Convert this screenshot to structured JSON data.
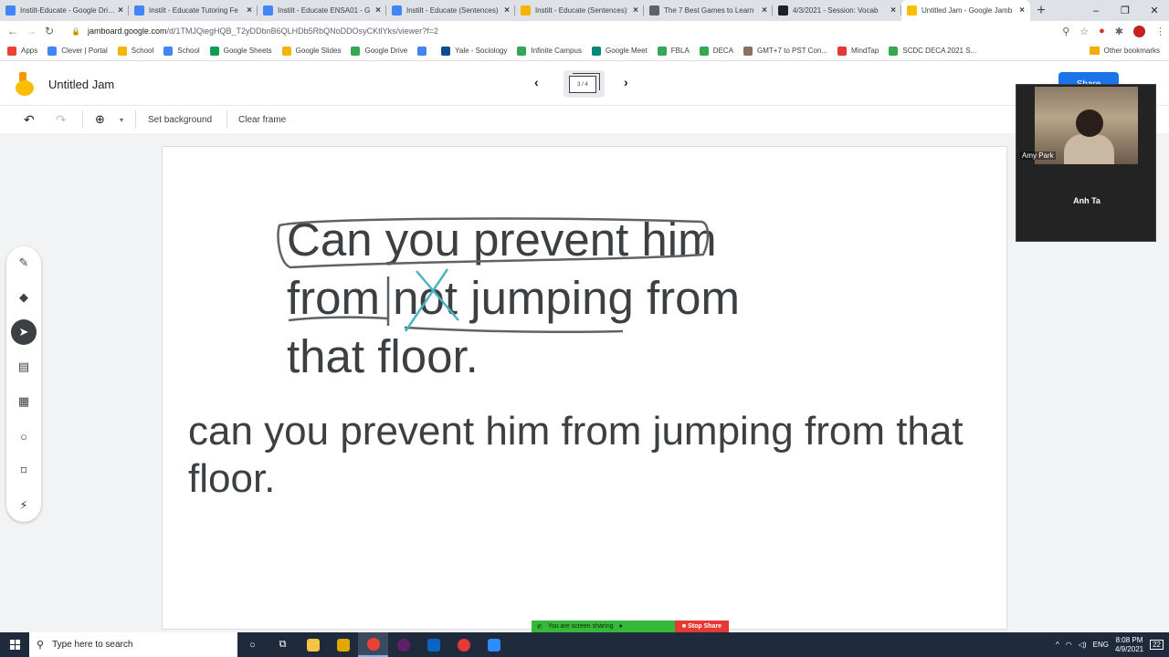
{
  "browser": {
    "tabs": [
      {
        "label": "Instilt-Educate - Google Drive",
        "color": "#4285f4"
      },
      {
        "label": "Instilt - Educate Tutoring Fe",
        "color": "#4285f4"
      },
      {
        "label": "Instilt - Educate ENSA01 - G",
        "color": "#4285f4"
      },
      {
        "label": "Instilt - Educate (Sentences)",
        "color": "#4285f4"
      },
      {
        "label": "Instilt - Educate (Sentences)",
        "color": "#f4b400"
      },
      {
        "label": "The 7 Best Games to Learn",
        "color": "#5f6368"
      },
      {
        "label": "4/3/2021 - Session: Vocab",
        "color": "#202124"
      },
      {
        "label": "Untitled Jam - Google Jamb",
        "color": "#fbbc04"
      }
    ],
    "new_tab": "+",
    "url_host": "jamboard.google.com",
    "url_path": "/d/1TMJQiegHQB_T2yDDbnB6QLHDb5RbQNoDDOsyCKtlYks/viewer?f=2",
    "bookmarks": [
      {
        "label": "Apps",
        "color": "#ea4335"
      },
      {
        "label": "Clever | Portal",
        "color": "#4285f4"
      },
      {
        "label": "School",
        "color": "#f4b400"
      },
      {
        "label": "School",
        "color": "#4285f4"
      },
      {
        "label": "Google Sheets",
        "color": "#0f9d58"
      },
      {
        "label": "Google Slides",
        "color": "#f4b400"
      },
      {
        "label": "Google Drive",
        "color": "#34a853"
      },
      {
        "label": "",
        "color": "#4285f4"
      },
      {
        "label": "Yale - Sociology",
        "color": "#0f4d92"
      },
      {
        "label": "Infinite Campus",
        "color": "#34a853"
      },
      {
        "label": "Google Meet",
        "color": "#00897b"
      },
      {
        "label": "FBLA",
        "color": "#34a853"
      },
      {
        "label": "DECA",
        "color": "#34a853"
      },
      {
        "label": "GMT+7 to PST Con...",
        "color": "#8d6e63"
      },
      {
        "label": "MindTap",
        "color": "#e53935"
      },
      {
        "label": "SCDC DECA 2021 S...",
        "color": "#34a853"
      }
    ],
    "other_bookmarks": "Other bookmarks"
  },
  "jam": {
    "title": "Untitled Jam",
    "frame_indicator": "3 / 4",
    "share_label": "Share",
    "toolbar": {
      "set_background": "Set background",
      "clear_frame": "Clear frame"
    },
    "canvas": {
      "line1": "Can you prevent him",
      "line2": "from not jumping from",
      "line3": "that floor.",
      "line4": "can you prevent him from jumping from that",
      "line5": "floor."
    },
    "annotation_colors": {
      "pen": "#5f6368",
      "cross": "#4fb3bf"
    }
  },
  "video": {
    "participant1": "Amy Park",
    "participant2": "Anh Ta"
  },
  "zoom_share": {
    "status": "You are screen sharing",
    "stop": "Stop Share"
  },
  "taskbar": {
    "search_placeholder": "Type here to search",
    "language": "ENG",
    "time": "8:08 PM",
    "date": "4/9/2021",
    "notifications": "22"
  }
}
